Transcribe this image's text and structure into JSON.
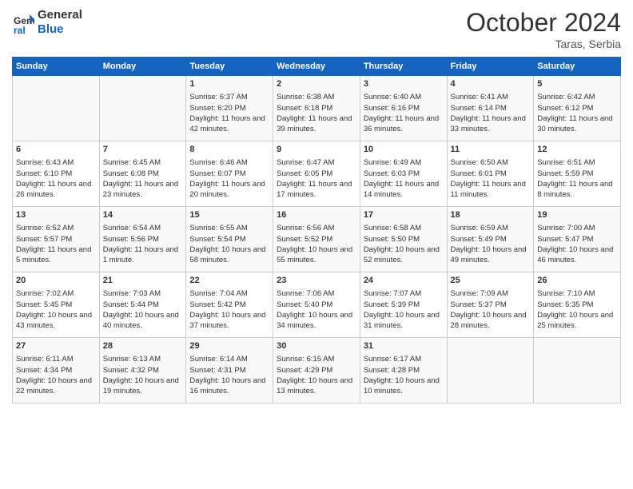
{
  "header": {
    "logo_line1": "General",
    "logo_line2": "Blue",
    "month_title": "October 2024",
    "location": "Taras, Serbia"
  },
  "days_of_week": [
    "Sunday",
    "Monday",
    "Tuesday",
    "Wednesday",
    "Thursday",
    "Friday",
    "Saturday"
  ],
  "weeks": [
    [
      {
        "day": "",
        "sunrise": "",
        "sunset": "",
        "daylight": ""
      },
      {
        "day": "",
        "sunrise": "",
        "sunset": "",
        "daylight": ""
      },
      {
        "day": "1",
        "sunrise": "Sunrise: 6:37 AM",
        "sunset": "Sunset: 6:20 PM",
        "daylight": "Daylight: 11 hours and 42 minutes."
      },
      {
        "day": "2",
        "sunrise": "Sunrise: 6:38 AM",
        "sunset": "Sunset: 6:18 PM",
        "daylight": "Daylight: 11 hours and 39 minutes."
      },
      {
        "day": "3",
        "sunrise": "Sunrise: 6:40 AM",
        "sunset": "Sunset: 6:16 PM",
        "daylight": "Daylight: 11 hours and 36 minutes."
      },
      {
        "day": "4",
        "sunrise": "Sunrise: 6:41 AM",
        "sunset": "Sunset: 6:14 PM",
        "daylight": "Daylight: 11 hours and 33 minutes."
      },
      {
        "day": "5",
        "sunrise": "Sunrise: 6:42 AM",
        "sunset": "Sunset: 6:12 PM",
        "daylight": "Daylight: 11 hours and 30 minutes."
      }
    ],
    [
      {
        "day": "6",
        "sunrise": "Sunrise: 6:43 AM",
        "sunset": "Sunset: 6:10 PM",
        "daylight": "Daylight: 11 hours and 26 minutes."
      },
      {
        "day": "7",
        "sunrise": "Sunrise: 6:45 AM",
        "sunset": "Sunset: 6:08 PM",
        "daylight": "Daylight: 11 hours and 23 minutes."
      },
      {
        "day": "8",
        "sunrise": "Sunrise: 6:46 AM",
        "sunset": "Sunset: 6:07 PM",
        "daylight": "Daylight: 11 hours and 20 minutes."
      },
      {
        "day": "9",
        "sunrise": "Sunrise: 6:47 AM",
        "sunset": "Sunset: 6:05 PM",
        "daylight": "Daylight: 11 hours and 17 minutes."
      },
      {
        "day": "10",
        "sunrise": "Sunrise: 6:49 AM",
        "sunset": "Sunset: 6:03 PM",
        "daylight": "Daylight: 11 hours and 14 minutes."
      },
      {
        "day": "11",
        "sunrise": "Sunrise: 6:50 AM",
        "sunset": "Sunset: 6:01 PM",
        "daylight": "Daylight: 11 hours and 11 minutes."
      },
      {
        "day": "12",
        "sunrise": "Sunrise: 6:51 AM",
        "sunset": "Sunset: 5:59 PM",
        "daylight": "Daylight: 11 hours and 8 minutes."
      }
    ],
    [
      {
        "day": "13",
        "sunrise": "Sunrise: 6:52 AM",
        "sunset": "Sunset: 5:57 PM",
        "daylight": "Daylight: 11 hours and 5 minutes."
      },
      {
        "day": "14",
        "sunrise": "Sunrise: 6:54 AM",
        "sunset": "Sunset: 5:56 PM",
        "daylight": "Daylight: 11 hours and 1 minute."
      },
      {
        "day": "15",
        "sunrise": "Sunrise: 6:55 AM",
        "sunset": "Sunset: 5:54 PM",
        "daylight": "Daylight: 10 hours and 58 minutes."
      },
      {
        "day": "16",
        "sunrise": "Sunrise: 6:56 AM",
        "sunset": "Sunset: 5:52 PM",
        "daylight": "Daylight: 10 hours and 55 minutes."
      },
      {
        "day": "17",
        "sunrise": "Sunrise: 6:58 AM",
        "sunset": "Sunset: 5:50 PM",
        "daylight": "Daylight: 10 hours and 52 minutes."
      },
      {
        "day": "18",
        "sunrise": "Sunrise: 6:59 AM",
        "sunset": "Sunset: 5:49 PM",
        "daylight": "Daylight: 10 hours and 49 minutes."
      },
      {
        "day": "19",
        "sunrise": "Sunrise: 7:00 AM",
        "sunset": "Sunset: 5:47 PM",
        "daylight": "Daylight: 10 hours and 46 minutes."
      }
    ],
    [
      {
        "day": "20",
        "sunrise": "Sunrise: 7:02 AM",
        "sunset": "Sunset: 5:45 PM",
        "daylight": "Daylight: 10 hours and 43 minutes."
      },
      {
        "day": "21",
        "sunrise": "Sunrise: 7:03 AM",
        "sunset": "Sunset: 5:44 PM",
        "daylight": "Daylight: 10 hours and 40 minutes."
      },
      {
        "day": "22",
        "sunrise": "Sunrise: 7:04 AM",
        "sunset": "Sunset: 5:42 PM",
        "daylight": "Daylight: 10 hours and 37 minutes."
      },
      {
        "day": "23",
        "sunrise": "Sunrise: 7:06 AM",
        "sunset": "Sunset: 5:40 PM",
        "daylight": "Daylight: 10 hours and 34 minutes."
      },
      {
        "day": "24",
        "sunrise": "Sunrise: 7:07 AM",
        "sunset": "Sunset: 5:39 PM",
        "daylight": "Daylight: 10 hours and 31 minutes."
      },
      {
        "day": "25",
        "sunrise": "Sunrise: 7:09 AM",
        "sunset": "Sunset: 5:37 PM",
        "daylight": "Daylight: 10 hours and 28 minutes."
      },
      {
        "day": "26",
        "sunrise": "Sunrise: 7:10 AM",
        "sunset": "Sunset: 5:35 PM",
        "daylight": "Daylight: 10 hours and 25 minutes."
      }
    ],
    [
      {
        "day": "27",
        "sunrise": "Sunrise: 6:11 AM",
        "sunset": "Sunset: 4:34 PM",
        "daylight": "Daylight: 10 hours and 22 minutes."
      },
      {
        "day": "28",
        "sunrise": "Sunrise: 6:13 AM",
        "sunset": "Sunset: 4:32 PM",
        "daylight": "Daylight: 10 hours and 19 minutes."
      },
      {
        "day": "29",
        "sunrise": "Sunrise: 6:14 AM",
        "sunset": "Sunset: 4:31 PM",
        "daylight": "Daylight: 10 hours and 16 minutes."
      },
      {
        "day": "30",
        "sunrise": "Sunrise: 6:15 AM",
        "sunset": "Sunset: 4:29 PM",
        "daylight": "Daylight: 10 hours and 13 minutes."
      },
      {
        "day": "31",
        "sunrise": "Sunrise: 6:17 AM",
        "sunset": "Sunset: 4:28 PM",
        "daylight": "Daylight: 10 hours and 10 minutes."
      },
      {
        "day": "",
        "sunrise": "",
        "sunset": "",
        "daylight": ""
      },
      {
        "day": "",
        "sunrise": "",
        "sunset": "",
        "daylight": ""
      }
    ]
  ]
}
